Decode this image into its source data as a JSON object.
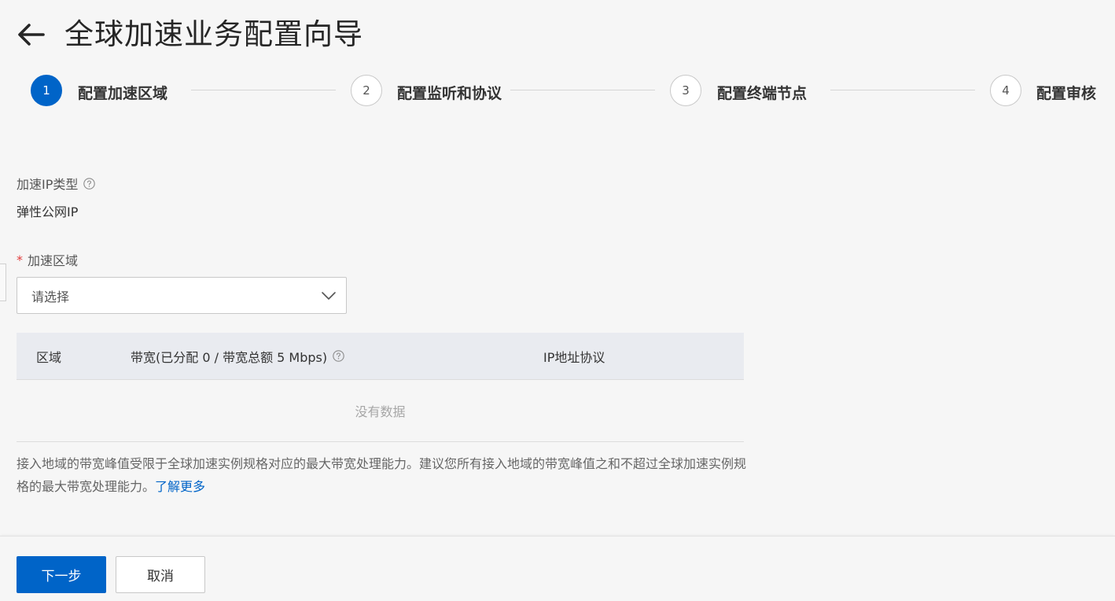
{
  "header": {
    "title": "全球加速业务配置向导"
  },
  "steps": [
    {
      "number": "1",
      "label": "配置加速区域",
      "active": true
    },
    {
      "number": "2",
      "label": "配置监听和协议",
      "active": false
    },
    {
      "number": "3",
      "label": "配置终端节点",
      "active": false
    },
    {
      "number": "4",
      "label": "配置审核",
      "active": false
    }
  ],
  "form": {
    "ip_type_label": "加速IP类型",
    "ip_type_value": "弹性公网IP",
    "region_required": "*",
    "region_label": "加速区域",
    "region_placeholder": "请选择"
  },
  "table": {
    "columns": [
      "区域",
      "带宽(已分配 0 / 带宽总额 5 Mbps)",
      "IP地址协议"
    ],
    "empty_text": "没有数据"
  },
  "note": {
    "text": "接入地域的带宽峰值受限于全球加速实例规格对应的最大带宽处理能力。建议您所有接入地域的带宽峰值之和不超过全球加速实例规格的最大带宽处理能力。",
    "link": "了解更多"
  },
  "footer": {
    "next_label": "下一步",
    "cancel_label": "取消"
  },
  "colors": {
    "primary": "#0064c8",
    "required": "#e23d3d"
  }
}
